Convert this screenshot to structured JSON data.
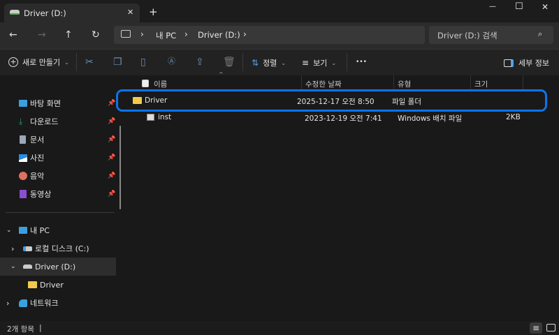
{
  "window": {
    "tab_title": "Driver (D:)",
    "new_tab": "+",
    "close_tab": "✕",
    "min": "—",
    "max": "☐",
    "close": "✕"
  },
  "nav": {
    "breadcrumb": [
      "내 PC",
      "Driver (D:)"
    ],
    "search_placeholder": "Driver (D:) 검색"
  },
  "toolbar": {
    "new": "새로 만들기",
    "sort": "정렬",
    "view": "보기",
    "more": "•••",
    "details": "세부 정보"
  },
  "sidebar": {
    "quick": [
      {
        "label": "바탕 화면",
        "icon": "desktop-icon",
        "color": "#3aa0e0"
      },
      {
        "label": "다운로드",
        "icon": "download-icon",
        "color": "#2a9d6a"
      },
      {
        "label": "문서",
        "icon": "document-icon",
        "color": "#9aa8b8"
      },
      {
        "label": "사진",
        "icon": "pictures-icon",
        "color": "#2a8be0"
      },
      {
        "label": "음악",
        "icon": "music-icon",
        "color": "#e07060"
      },
      {
        "label": "동영상",
        "icon": "video-icon",
        "color": "#8a4fd0"
      }
    ],
    "tree": [
      {
        "label": "내 PC",
        "expanded": true
      },
      {
        "label": "로컬 디스크 (C:)",
        "expanded": false
      },
      {
        "label": "Driver (D:)",
        "expanded": true,
        "selected": true
      },
      {
        "label": "Driver"
      },
      {
        "label": "네트워크",
        "expanded": false
      }
    ]
  },
  "columns": [
    "이름",
    "수정한 날짜",
    "유형",
    "크기"
  ],
  "files": [
    {
      "name": "Driver",
      "date": "2025-12-17 오전 8:50",
      "type": "파일 폴더",
      "size": "",
      "icon": "folder-icon",
      "highlighted": true
    },
    {
      "name": "inst",
      "date": "2023-12-19 오전 7:41",
      "type": "Windows 배치 파일",
      "size": "2KB",
      "icon": "batch-file-icon"
    }
  ],
  "status": {
    "count": "2개 항목"
  },
  "colors": {
    "highlight": "#0a74ef",
    "folder": "#f2c94c"
  }
}
